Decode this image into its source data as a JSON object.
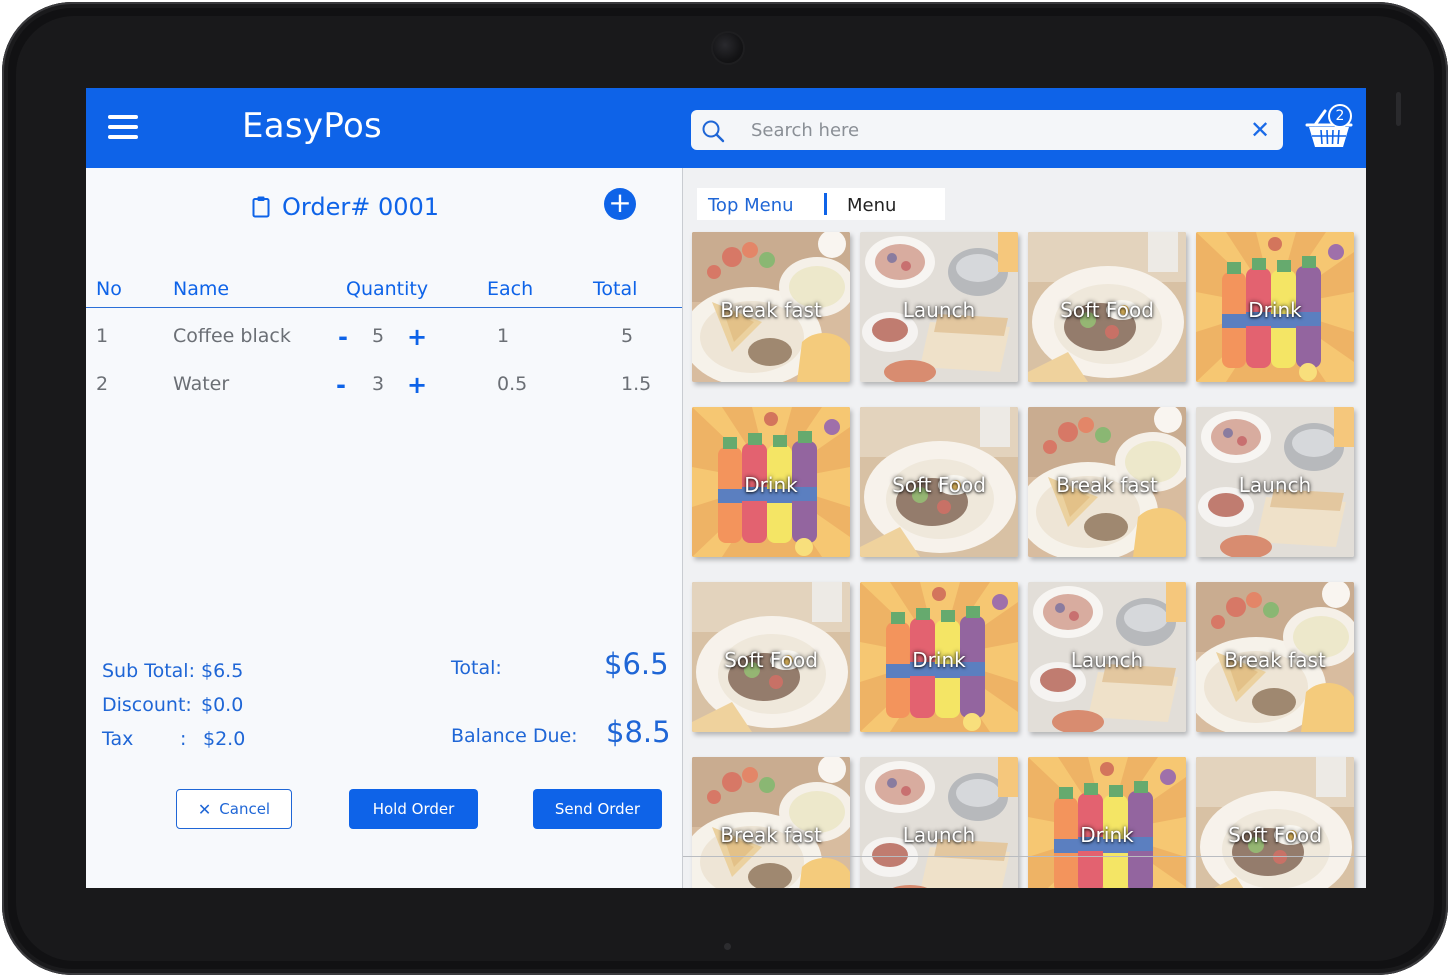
{
  "app": {
    "title": "EasyPos"
  },
  "search": {
    "placeholder": "Search here",
    "value": ""
  },
  "cart": {
    "count": "2"
  },
  "order": {
    "title": "Order# 0001",
    "columns": {
      "no": "No",
      "name": "Name",
      "quantity": "Quantity",
      "each": "Each",
      "total": "Total"
    },
    "items": [
      {
        "no": "1",
        "name": "Coffee black",
        "minus": "-",
        "qty": "5",
        "plus": "+",
        "each": "1",
        "total": "5"
      },
      {
        "no": "2",
        "name": "Water",
        "minus": "-",
        "qty": "3",
        "plus": "+",
        "each": "0.5",
        "total": "1.5"
      }
    ],
    "summary": {
      "sub_total_label": "Sub Total:",
      "sub_total": "$6.5",
      "discount_label": "Discount:",
      "discount": "$0.0",
      "tax_label": "Tax",
      "tax_colon": ":",
      "tax": "$2.0",
      "total_label": "Total:",
      "total": "$6.5",
      "balance_label": "Balance Due:",
      "balance": "$8.5"
    },
    "buttons": {
      "cancel": "Cancel",
      "hold": "Hold Order",
      "send": "Send Order"
    }
  },
  "menu": {
    "tabs": {
      "top": "Top Menu",
      "menu": "Menu"
    },
    "tiles": [
      {
        "label": "Break fast",
        "kind": "breakfast"
      },
      {
        "label": "Launch",
        "kind": "lunch"
      },
      {
        "label": "Soft Food",
        "kind": "soft"
      },
      {
        "label": "Drink",
        "kind": "drink"
      },
      {
        "label": "Drink",
        "kind": "drink"
      },
      {
        "label": "Soft Food",
        "kind": "soft"
      },
      {
        "label": "Break fast",
        "kind": "breakfast"
      },
      {
        "label": "Launch",
        "kind": "lunch"
      },
      {
        "label": "Soft Food",
        "kind": "soft"
      },
      {
        "label": "Drink",
        "kind": "drink"
      },
      {
        "label": "Launch",
        "kind": "lunch"
      },
      {
        "label": "Break fast",
        "kind": "breakfast"
      },
      {
        "label": "Break fast",
        "kind": "breakfast"
      },
      {
        "label": "Launch",
        "kind": "lunch"
      },
      {
        "label": "Drink",
        "kind": "drink"
      },
      {
        "label": "Soft Food",
        "kind": "soft"
      }
    ]
  },
  "colors": {
    "primary": "#0e63e8",
    "text_muted": "#6b6f75",
    "frame": "#111113"
  }
}
